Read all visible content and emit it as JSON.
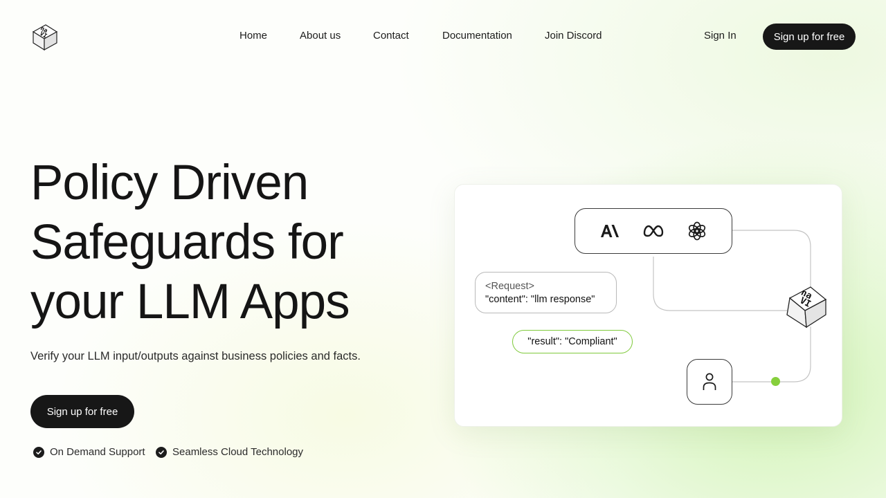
{
  "brand": {
    "logo_text": "na\nVI",
    "logo_icon": "navi-cube-logo"
  },
  "nav": {
    "links": [
      {
        "label": "Home"
      },
      {
        "label": "About us"
      },
      {
        "label": "Contact"
      },
      {
        "label": "Documentation"
      },
      {
        "label": "Join Discord"
      }
    ],
    "sign_in": "Sign In",
    "signup_button": "Sign up for free"
  },
  "hero": {
    "title_lines": [
      "Policy Driven",
      "Safeguards for",
      "your LLM Apps"
    ],
    "subtitle": "Verify your LLM input/outputs against business policies and facts.",
    "cta": "Sign up for free",
    "features": [
      {
        "label": "On Demand Support",
        "icon": "check-circle-icon"
      },
      {
        "label": "Seamless Cloud Technology",
        "icon": "check-circle-icon"
      }
    ]
  },
  "diagram": {
    "providers": [
      {
        "name": "anthropic-icon"
      },
      {
        "name": "meta-icon"
      },
      {
        "name": "openai-icon"
      }
    ],
    "request_tag": "<Request>",
    "request_body": "\"content\": \"llm response\"",
    "result": "\"result\": \"Compliant\"",
    "user_icon": "user-icon",
    "cube_text": "na\nVI"
  },
  "colors": {
    "accent_green": "#86cf3c",
    "button_dark": "#171717",
    "text": "#151515"
  }
}
